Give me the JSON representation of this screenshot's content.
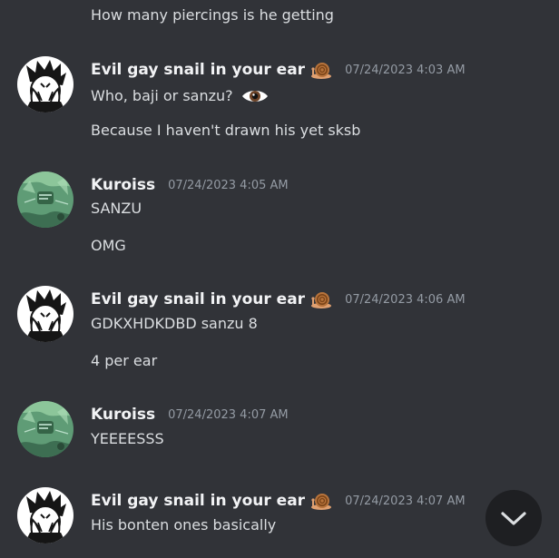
{
  "messages": {
    "m0": {
      "text": "How many piercings is he getting"
    },
    "g1": {
      "author": "Evil gay snail in your ear",
      "timestamp": "07/24/2023 4:03 AM",
      "line1": "Who, baji or sanzu?",
      "line2": "Because I haven't drawn his yet sksb"
    },
    "g2": {
      "author": "Kuroiss",
      "timestamp": "07/24/2023 4:05 AM",
      "line1": "SANZU",
      "line2": "OMG"
    },
    "g3": {
      "author": "Evil gay snail in your ear",
      "timestamp": "07/24/2023 4:06 AM",
      "line1": "GDKXHDKDBD sanzu 8",
      "line2": "4 per ear"
    },
    "g4": {
      "author": "Kuroiss",
      "timestamp": "07/24/2023 4:07 AM",
      "line1": "YEEEESSS"
    },
    "g5": {
      "author": "Evil gay snail in your ear",
      "timestamp": "07/24/2023 4:07 AM",
      "line1": "His bonten ones basically"
    }
  },
  "icons": {
    "author_badge": "snail-emoji-icon",
    "inline_emoji": "eye-emoji-icon",
    "jump_button": "chevron-down-icon"
  },
  "colors": {
    "background": "#313338",
    "username": "#f2f3f5",
    "text": "#dbdee1",
    "timestamp": "#949ba4",
    "jump_button": "#1e1f22"
  }
}
